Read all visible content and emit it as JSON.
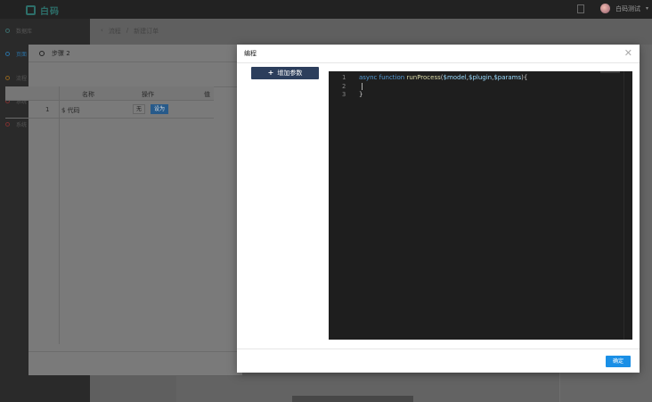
{
  "app": {
    "logo_text": "白码",
    "user_name": "白码测试"
  },
  "sidebar": {
    "items": [
      {
        "label": "数据库"
      },
      {
        "label": "页面"
      },
      {
        "label": "流程"
      },
      {
        "label": "系统"
      },
      {
        "label": "系统"
      }
    ]
  },
  "breadcrumb": {
    "root": "流程",
    "sep": "/",
    "current": "新建订单"
  },
  "step_dialog": {
    "title": "步骤 2",
    "columns": [
      "名称",
      "操作",
      "值"
    ],
    "rows": [
      {
        "index": "1",
        "name": "$ 代码",
        "none_label": "无",
        "set_label": "设为"
      }
    ]
  },
  "code_dialog": {
    "title": "编程",
    "add_param_label": "增加参数",
    "confirm_label": "确定",
    "line_numbers": [
      "1",
      "2",
      "3"
    ],
    "code": {
      "line1_async": "async",
      "line1_function": "function",
      "line1_name": "runProcess",
      "line1_open": "(",
      "line1_p1": "$model",
      "line1_c1": ",",
      "line1_p2": "$plugin",
      "line1_c2": ",",
      "line1_p3": "$params",
      "line1_close": "){",
      "line3": "}"
    }
  },
  "colors": {
    "accent": "#1a8fe6",
    "add_button": "#2c3e5c",
    "editor_bg": "#1e1e1e",
    "keyword": "#569cd6"
  }
}
